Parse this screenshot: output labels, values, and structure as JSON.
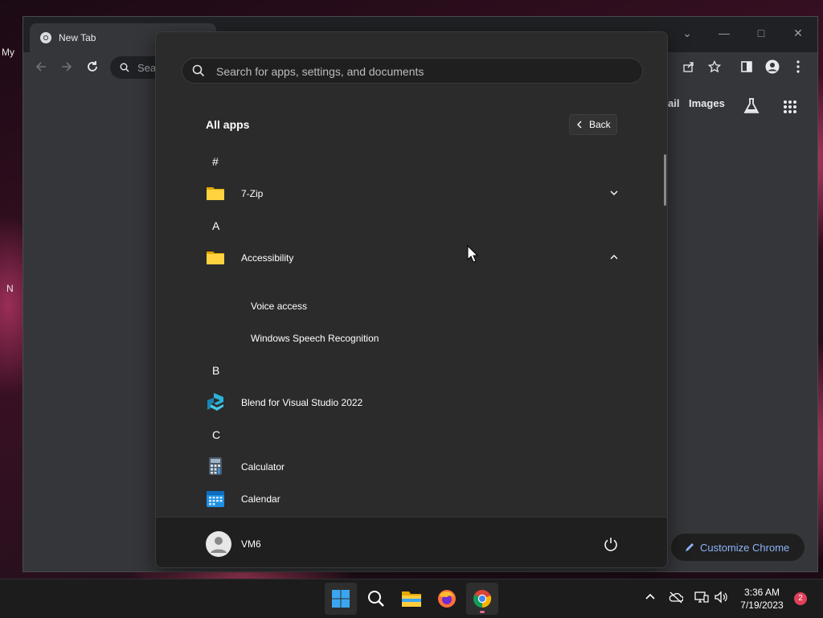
{
  "desktop": {
    "labels": [
      "My",
      "N"
    ]
  },
  "chrome": {
    "tab_title": "New Tab",
    "omnibox_placeholder": "Sea",
    "ntp_links": [
      "ail",
      "Images"
    ],
    "customize_label": "Customize Chrome",
    "accent_color": "#8ab4f8"
  },
  "start_menu": {
    "search_placeholder": "Search for apps, settings, and documents",
    "title": "All apps",
    "back_label": "Back",
    "letters": [
      "#",
      "A",
      "B",
      "C"
    ],
    "apps": [
      {
        "name": "7-Zip",
        "icon": "folder-icon",
        "expand": "chevron-down-icon"
      },
      {
        "name": "Accessibility",
        "icon": "folder-icon",
        "expand": "chevron-up-icon"
      },
      {
        "name": "Voice access",
        "icon": ""
      },
      {
        "name": "Windows Speech Recognition",
        "icon": ""
      },
      {
        "name": "Blend for Visual Studio 2022",
        "icon": "blend-icon"
      },
      {
        "name": "Calculator",
        "icon": "calculator-icon"
      },
      {
        "name": "Calendar",
        "icon": "calendar-icon"
      }
    ],
    "user_name": "VM6"
  },
  "taskbar": {
    "apps": [
      "start-icon",
      "search-icon",
      "file-explorer-icon",
      "firefox-icon",
      "chrome-icon"
    ],
    "time": "3:36 AM",
    "date": "7/19/2023",
    "notification_count": "2"
  }
}
